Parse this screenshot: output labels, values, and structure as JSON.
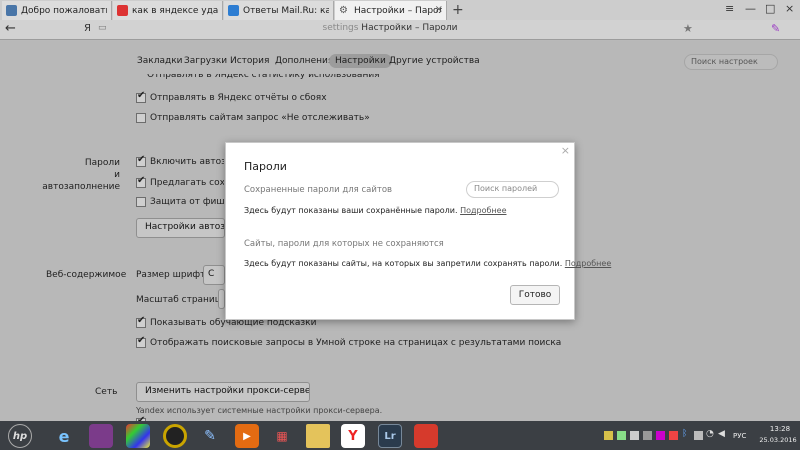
{
  "browser": {
    "tabs": [
      {
        "title": "Добро пожаловать | ВКонтак",
        "favicon_color": "#4a76a8",
        "active": false
      },
      {
        "title": "как в яндексе удалить сохра",
        "favicon_color": "#d33",
        "active": false
      },
      {
        "title": "Ответы Mail.Ru: как удалить",
        "favicon_color": "#2d7dd2",
        "active": false
      },
      {
        "title": "Настройки – Пароли",
        "favicon_color": "#777",
        "active": true
      }
    ],
    "new_tab_label": "+",
    "address": {
      "prefix": "settings",
      "title": "Настройки – Пароли"
    },
    "back_label": "←",
    "yandex_label": "Я"
  },
  "nav": {
    "items": [
      "Закладки",
      "Загрузки",
      "История",
      "Дополнения",
      "Настройки",
      "Другие устройства"
    ],
    "search_placeholder": "Поиск настроек"
  },
  "settings": {
    "top_cut_text": "Отправлять в Яндекс статистику использования",
    "send_reports": "Отправлять в Яндекс отчёты о сбоях",
    "dnt": "Отправлять сайтам запрос «Не отслеживать»",
    "passwords_section": "Пароли\nи автозаполнение",
    "enable_autofill": "Включить автозаполнение",
    "offer_save": "Предлагать сохранять пароли",
    "phishing": "Защита от фишинга",
    "autofill_button": "Настройки автозаполнения",
    "web_section": "Веб-содержимое",
    "font_size": "Размер шрифта:",
    "font_select": "С",
    "page_zoom": "Масштаб страницы:",
    "show_hints": "Показывать обучающие подсказки",
    "show_queries": "Отображать поисковые запросы в Умной строке на страницах с результатами поиска",
    "network_section": "Сеть",
    "proxy_button": "Изменить настройки прокси-сервера...",
    "proxy_note": "Yandex использует системные настройки прокси-сервера."
  },
  "modal": {
    "title": "Пароли",
    "saved_label": "Сохраненные пароли для сайтов",
    "search_placeholder": "Поиск паролей",
    "saved_text": "Здесь будут показаны ваши сохранённые пароли.",
    "more_link": "Подробнее",
    "never_label": "Сайты, пароли для которых не сохраняются",
    "never_text": "Здесь будут показаны сайты, на которых вы запретили сохранять пароли.",
    "more_link2": "Подробнее",
    "done_button": "Готово",
    "close_icon": "×"
  },
  "taskbar": {
    "lang": "РУС",
    "time": "13:28",
    "date": "25.03.2016",
    "apps": [
      {
        "name": "hp",
        "label": "hp",
        "color": "#3b3f44"
      },
      {
        "name": "ie",
        "label": "e",
        "color": "#1e8fd6"
      },
      {
        "name": "app2",
        "label": "",
        "color": "#7b3b8a"
      },
      {
        "name": "app3",
        "label": "",
        "color": "#222"
      },
      {
        "name": "app4",
        "label": "",
        "color": "#c9a400"
      },
      {
        "name": "app5",
        "label": "",
        "color": "#5a8fc8"
      },
      {
        "name": "media",
        "label": "▶",
        "color": "#e36b12"
      },
      {
        "name": "tiles",
        "label": "",
        "color": "#444"
      },
      {
        "name": "explorer",
        "label": "",
        "color": "#e4c35b"
      },
      {
        "name": "yandex",
        "label": "Y",
        "color": "#ffffff"
      },
      {
        "name": "lightroom",
        "label": "Lr",
        "color": "#2a3b4d"
      },
      {
        "name": "app11",
        "label": "",
        "color": "#d63a2c"
      }
    ]
  }
}
